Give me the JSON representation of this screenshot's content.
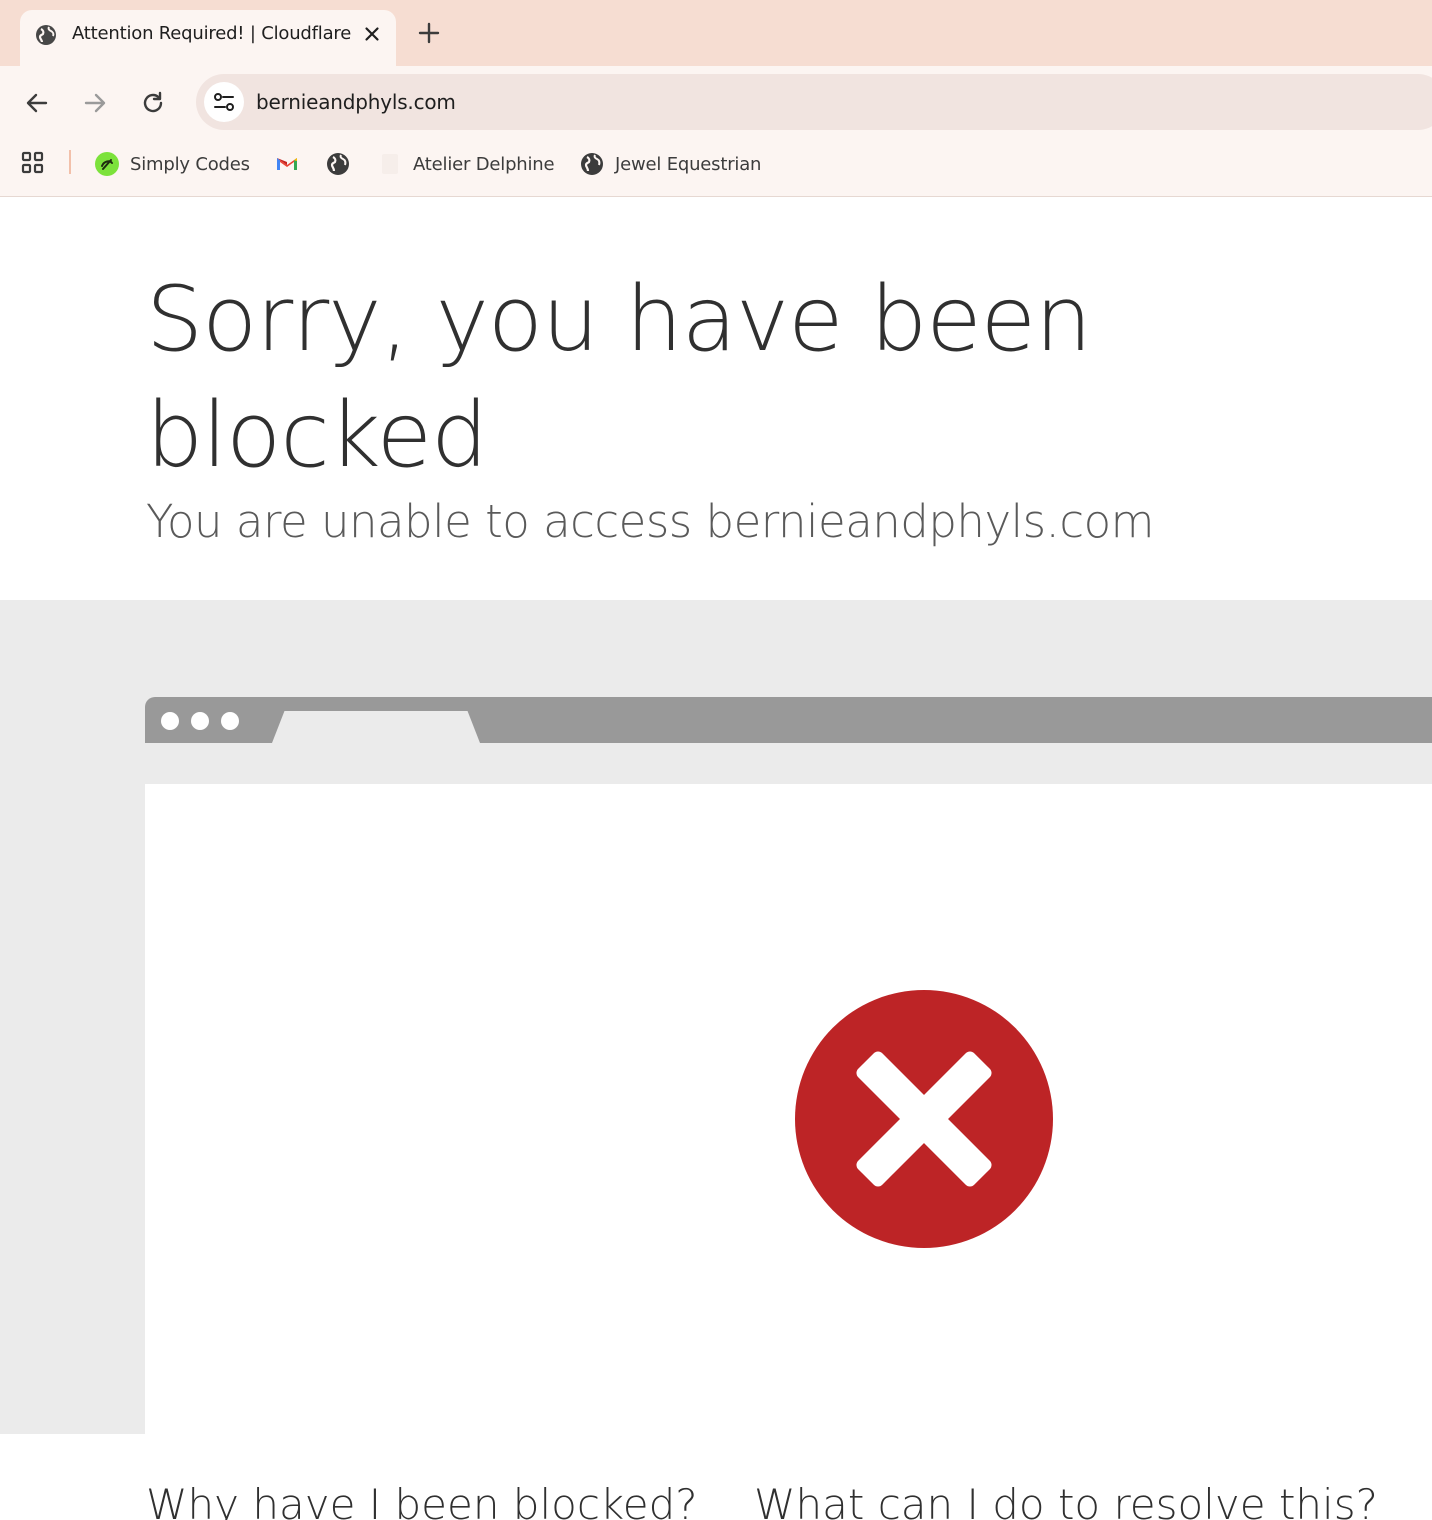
{
  "browser": {
    "tab": {
      "title": "Attention Required! | Cloudflare"
    },
    "url": "bernieandphyls.com",
    "bookmarks": [
      {
        "label": "Simply Codes",
        "icon": "simply-codes-icon"
      },
      {
        "label": "",
        "icon": "gmail-icon"
      },
      {
        "label": "",
        "icon": "globe-icon"
      },
      {
        "label": "Atelier Delphine",
        "icon": "blank-page-icon"
      },
      {
        "label": "Jewel Equestrian",
        "icon": "globe-icon"
      }
    ]
  },
  "page": {
    "title": "Sorry, you have been blocked",
    "subtitle": "You are unable to access bernieandphyls.com",
    "below_left": "Why have I been blocked?",
    "below_right": "What can I do to resolve this?"
  },
  "colors": {
    "tabstrip": "#f6ddd2",
    "toolbar": "#fcf5f2",
    "error_red": "#bd2426",
    "band_gray": "#ebebeb",
    "mock_bar": "#999999"
  }
}
